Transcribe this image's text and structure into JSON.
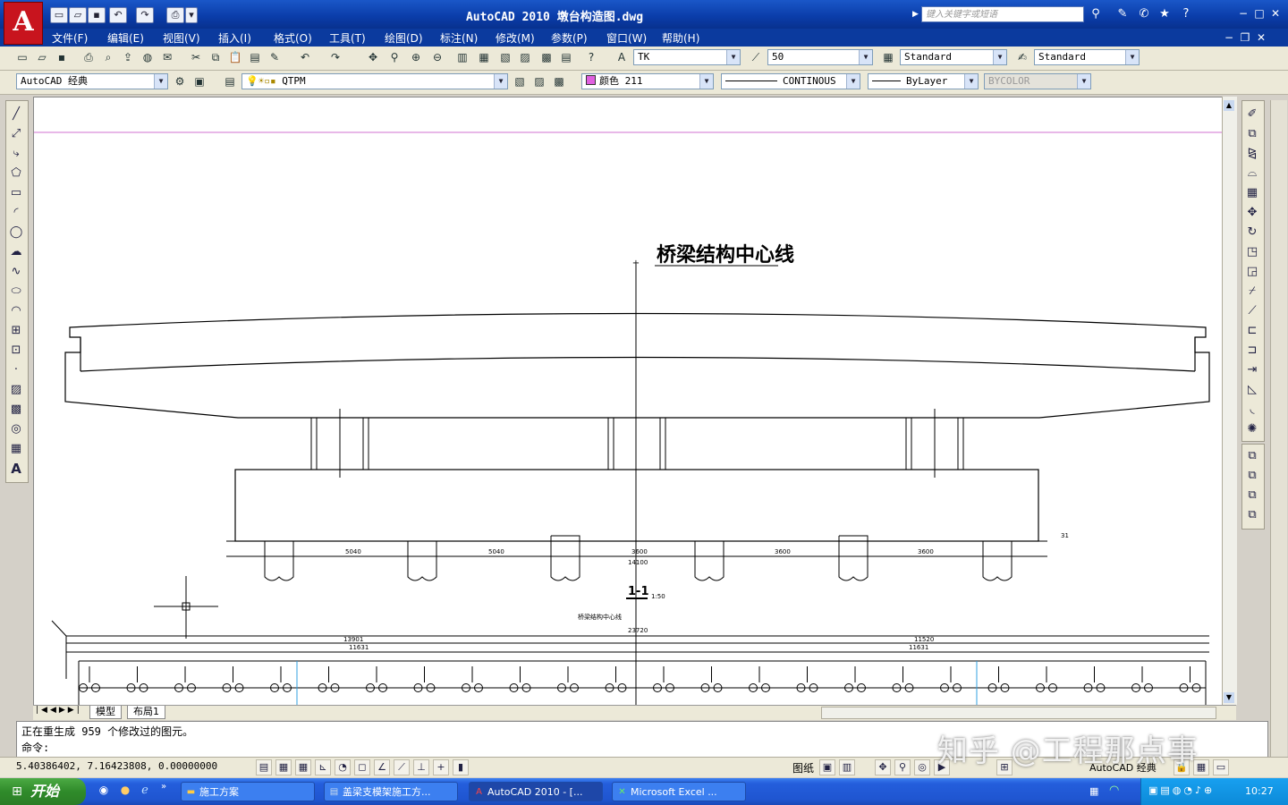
{
  "window": {
    "title": "AutoCAD 2010   墩台构造图.dwg",
    "search_placeholder": "键入关键字或短语"
  },
  "menus": [
    "文件(F)",
    "编辑(E)",
    "视图(V)",
    "插入(I)",
    "格式(O)",
    "工具(T)",
    "绘图(D)",
    "标注(N)",
    "修改(M)",
    "参数(P)",
    "窗口(W)",
    "帮助(H)"
  ],
  "toolbar1": {
    "text_style": "TK",
    "dim_scale": "50",
    "dim_style": "Standard",
    "table_style": "Standard"
  },
  "toolbar2": {
    "workspace": "AutoCAD 经典",
    "layer": "QTPM",
    "color": "颜色 211",
    "linetype": "CONTINOUS",
    "lineweight": "ByLayer",
    "plotstyle": "BYCOLOR"
  },
  "drawing": {
    "centerline_label": "桥梁结构中心线",
    "section_label": "1-1",
    "section_scale": "1:50",
    "plan_center_label": "桥梁结构中心线",
    "top_dims": [
      "5040",
      "5040",
      "3600",
      "3600",
      "3600"
    ],
    "total_dim": "14100",
    "right_dim": "31",
    "plan_dims": {
      "left": "13901",
      "right": "11520",
      "left_sub": "11631",
      "right_sub": "11631",
      "center": "23720"
    }
  },
  "tabs": {
    "model": "模型",
    "layout1": "布局1"
  },
  "command": {
    "history": "正在重生成  959  个修改过的图元。",
    "prompt": "命令:"
  },
  "status": {
    "coords": "5.40386402, 7.16423808, 0.00000000",
    "paper": "图纸",
    "workspace": "AutoCAD 经典"
  },
  "taskbar": {
    "start": "开始",
    "tasks": [
      "施工方案",
      "盖梁支模架施工方...",
      "AutoCAD 2010 - [...",
      "Microsoft Excel ..."
    ],
    "clock": "10:27"
  },
  "watermark": "知乎 @工程那点事"
}
